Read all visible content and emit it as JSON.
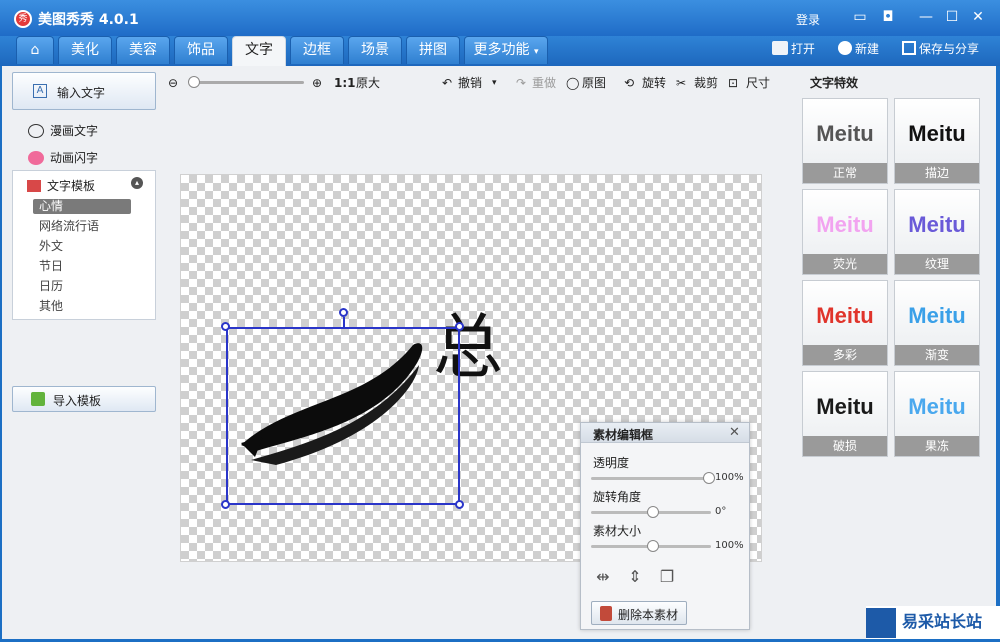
{
  "app": {
    "title": "美图秀秀 4.0.1",
    "login": "登录"
  },
  "tabs": [
    {
      "label": "美化"
    },
    {
      "label": "美容"
    },
    {
      "label": "饰品"
    },
    {
      "label": "文字"
    },
    {
      "label": "边框"
    },
    {
      "label": "场景"
    },
    {
      "label": "拼图"
    },
    {
      "label": "更多功能"
    }
  ],
  "active_tab": "文字",
  "actions": {
    "open": "打开",
    "new": "新建",
    "save_share": "保存与分享"
  },
  "sidebar": {
    "input_text": "输入文字",
    "comic_text": "漫画文字",
    "animated_text": "动画闪字",
    "template_header": "文字模板",
    "template_items": [
      "心情",
      "网络流行语",
      "外文",
      "节日",
      "日历",
      "其他"
    ],
    "selected_template": "心情",
    "import_template": "导入模板"
  },
  "toolbar": {
    "ratio": "1:1",
    "original_size": "原大",
    "undo": "撤销",
    "redo": "重做",
    "original": "原图",
    "rotate": "旋转",
    "crop": "裁剪",
    "size": "尺寸"
  },
  "canvas": {
    "character": "总"
  },
  "effects": {
    "title": "文字特效",
    "items": [
      {
        "sample": "Meitu",
        "label": "正常",
        "color": "#555555"
      },
      {
        "sample": "Meitu",
        "label": "描边",
        "color": "#111111"
      },
      {
        "sample": "Meitu",
        "label": "荧光",
        "color": "#f2a3f0"
      },
      {
        "sample": "Meitu",
        "label": "纹理",
        "color": "#6a5ad8"
      },
      {
        "sample": "Meitu",
        "label": "多彩",
        "color": "#e0342b"
      },
      {
        "sample": "Meitu",
        "label": "渐变",
        "color": "#3aa0e8"
      },
      {
        "sample": "Meitu",
        "label": "破损",
        "color": "#1a1a1a"
      },
      {
        "sample": "Meitu",
        "label": "果冻",
        "color": "#4aa8ee"
      }
    ]
  },
  "material_panel": {
    "title": "素材编辑框",
    "opacity_label": "透明度",
    "opacity_value": "100%",
    "opacity": 1.0,
    "rotation_label": "旋转角度",
    "rotation_value": "0°",
    "rotation": 0.5,
    "size_label": "素材大小",
    "size_value": "100%",
    "size": 0.5,
    "delete_button": "删除本素材"
  },
  "watermark": {
    "text": "易采站长站"
  }
}
